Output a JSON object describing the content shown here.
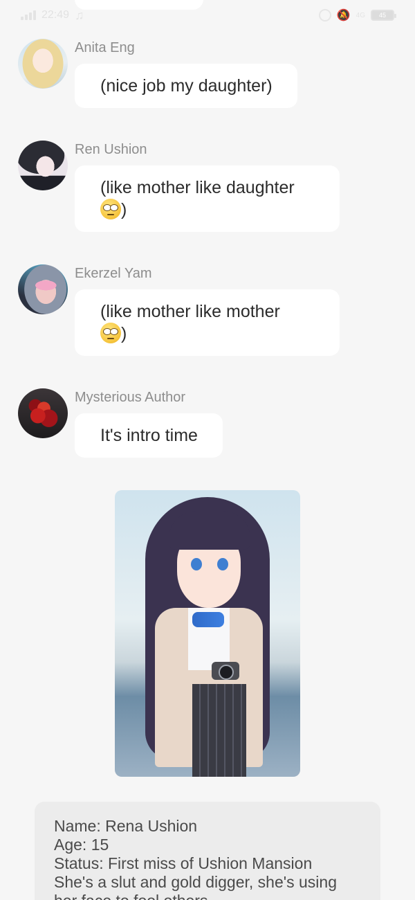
{
  "status_bar": {
    "time": "22:49",
    "battery": "45",
    "network": "4G"
  },
  "messages": [
    {
      "sender": "Anita Eng",
      "text": "(nice job my daughter)",
      "emoji": false
    },
    {
      "sender": "Ren Ushion",
      "text_line1": "(like mother like daughter",
      "text_line2": ")",
      "emoji": "face-with-rolling-eyes"
    },
    {
      "sender": "Ekerzel Yam",
      "text_line1": "(like mother like mother",
      "text_line2": ")",
      "emoji": "face-with-rolling-eyes"
    },
    {
      "sender": "Mysterious Author",
      "text": "It's intro time",
      "emoji": false
    }
  ],
  "intro_card": {
    "name": "Name: Rena Ushion",
    "age": "Age: 15",
    "status": "Status: First miss of Ushion Mansion",
    "desc_line1": "She's a slut and gold digger, she's using",
    "desc_line2": "her face to fool others"
  }
}
